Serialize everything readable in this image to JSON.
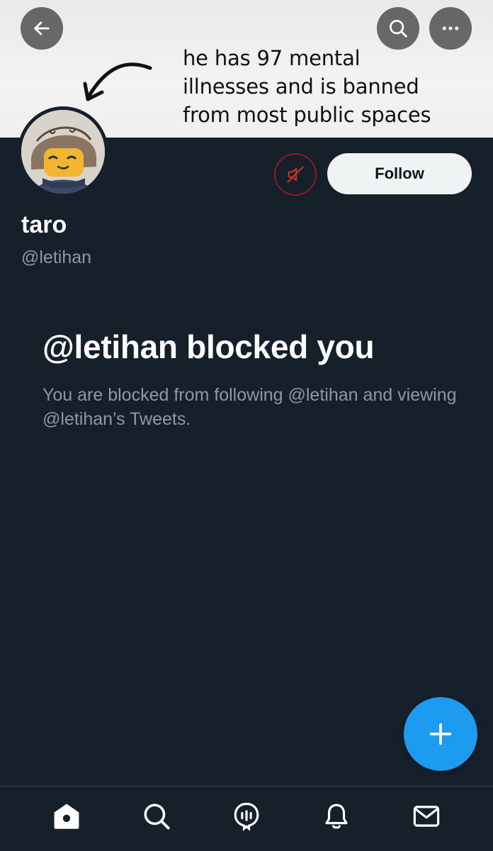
{
  "banner": {
    "text": "he has 97 mental\nillnesses and is banned\nfrom most public spaces"
  },
  "header": {
    "back_icon": "arrow-left-icon",
    "search_icon": "search-icon",
    "more_icon": "more-icon"
  },
  "profile": {
    "name": "taro",
    "handle": "@letihan",
    "follow_label": "Follow",
    "mute_icon": "muted-speaker-icon"
  },
  "blocked": {
    "title": "@letihan blocked you",
    "description": "You are blocked from following @letihan and viewing @letihan’s Tweets."
  },
  "fab": {
    "icon": "plus-icon"
  },
  "bottom_nav": {
    "items": [
      "home-icon",
      "search-icon",
      "spaces-icon",
      "notifications-icon",
      "messages-icon"
    ]
  },
  "colors": {
    "background": "#15202b",
    "accent": "#1d9bf0",
    "mute_border": "#8b1d1d"
  }
}
